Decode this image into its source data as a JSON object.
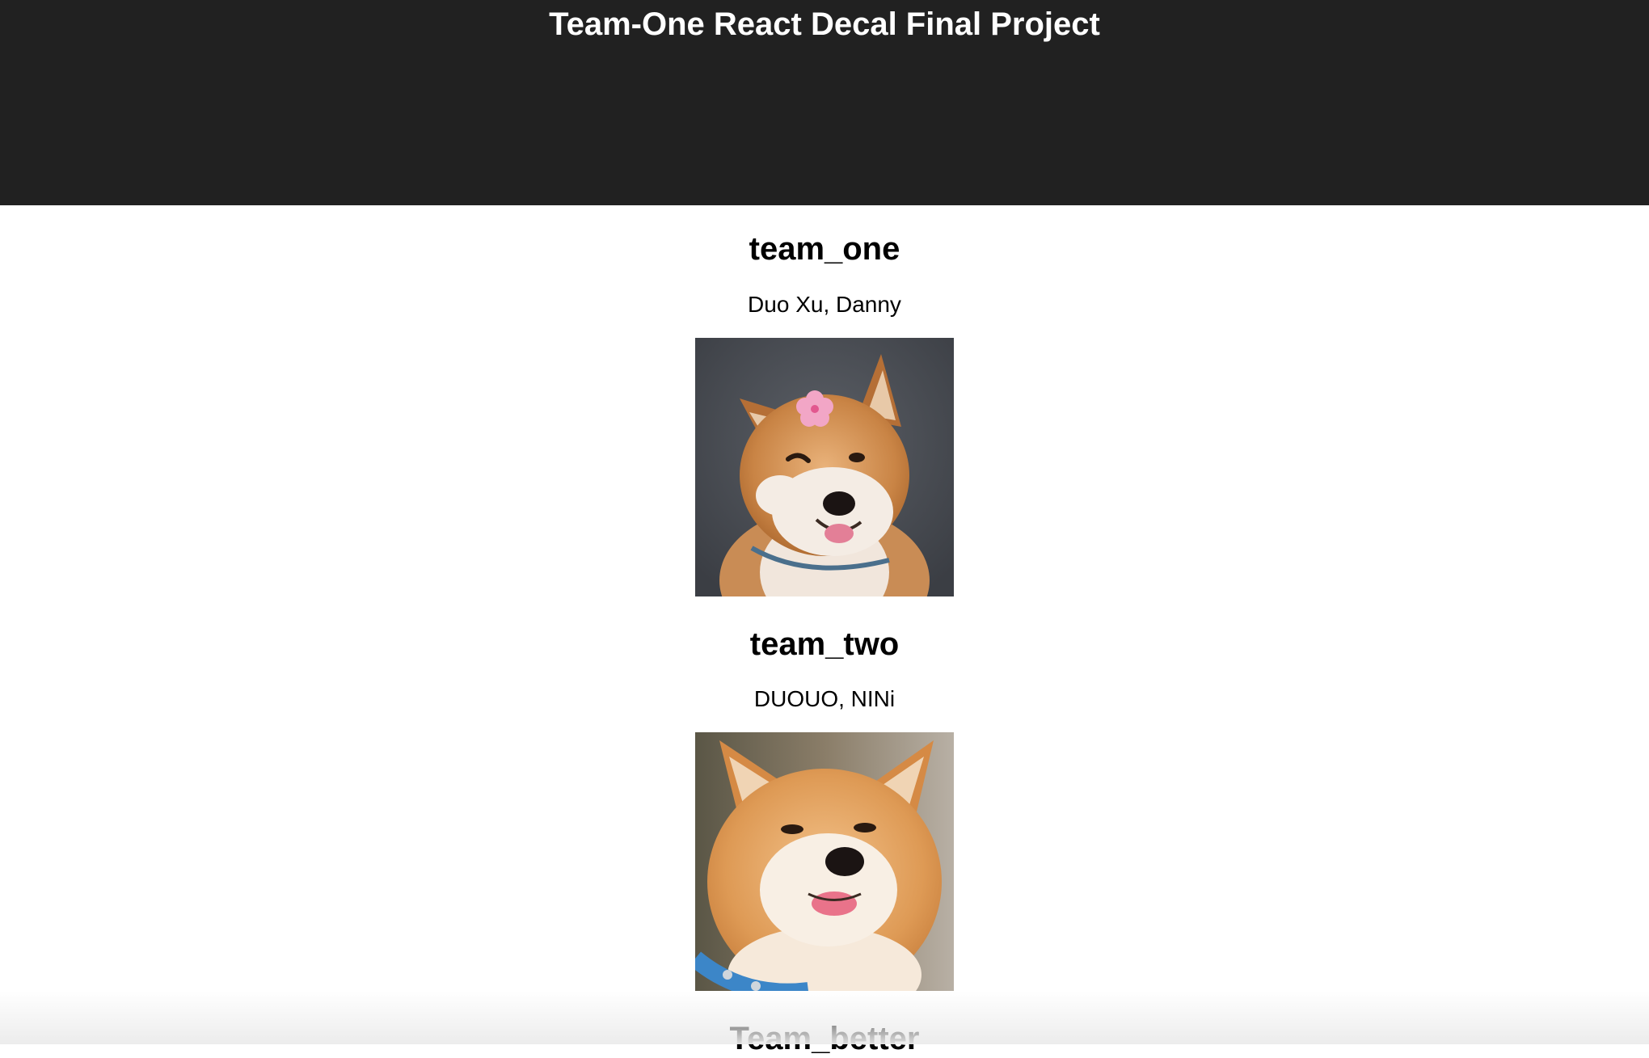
{
  "header": {
    "title": "Team-One React Decal Final Project"
  },
  "teams": [
    {
      "name": "team_one",
      "members": "Duo Xu, Danny",
      "photo_icon": "shiba-inu-with-flower-photo"
    },
    {
      "name": "team_two",
      "members": "DUOUO, NINi",
      "photo_icon": "shiba-inu-tongue-out-photo"
    },
    {
      "name": "Team_better",
      "members": "",
      "photo_icon": ""
    }
  ],
  "colors": {
    "header_bg": "#212121",
    "header_text": "#ffffff",
    "page_bg": "#ffffff"
  }
}
